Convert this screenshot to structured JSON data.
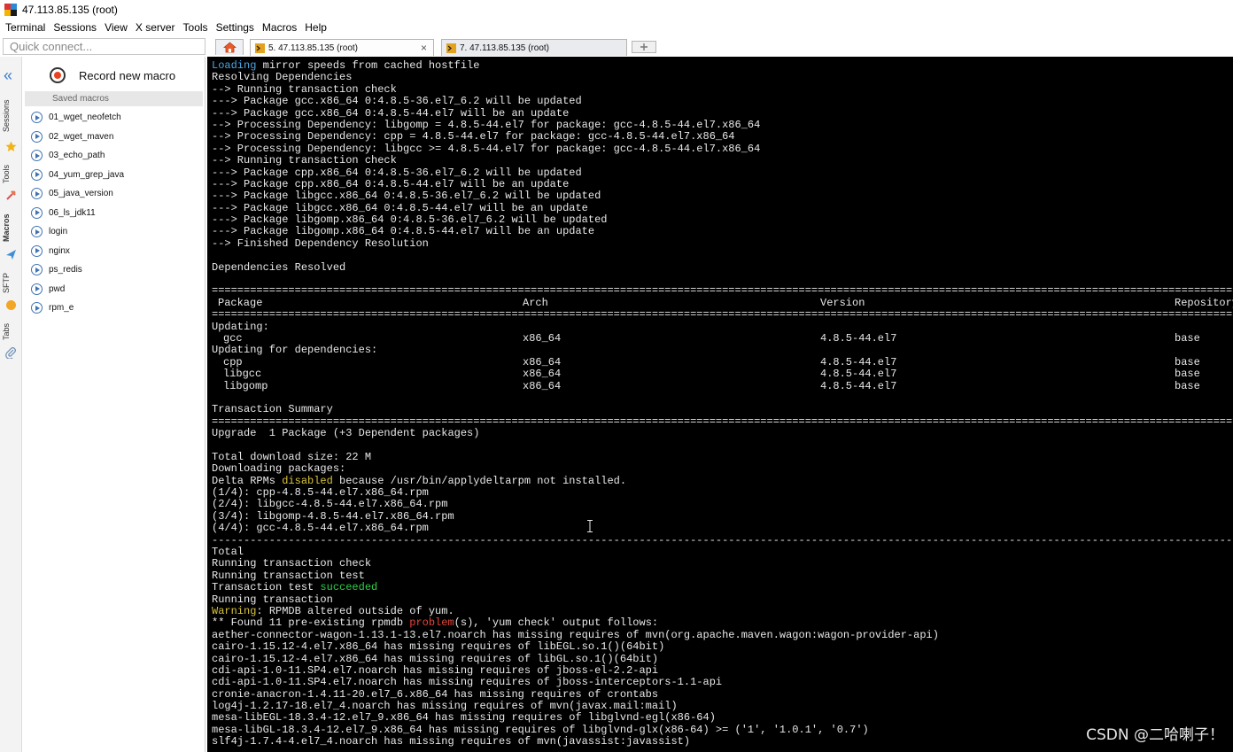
{
  "window": {
    "title": "47.113.85.135 (root)"
  },
  "menu": [
    "Terminal",
    "Sessions",
    "View",
    "X server",
    "Tools",
    "Settings",
    "Macros",
    "Help"
  ],
  "quick_connect": {
    "placeholder": "Quick connect..."
  },
  "tabs": [
    {
      "label": "5. 47.113.85.135 (root)",
      "active": true,
      "close": "×"
    },
    {
      "label": "7. 47.113.85.135 (root)",
      "active": false
    }
  ],
  "side_tabs": [
    "Sessions",
    "Tools",
    "Macros",
    "SFTP",
    "Tabs"
  ],
  "macros": {
    "record_label": "Record new macro",
    "saved_header": "Saved macros",
    "items": [
      "01_wget_neofetch",
      "02_wget_maven",
      "03_echo_path",
      "04_yum_grep_java",
      "05_java_version",
      "06_ls_jdk11",
      "login",
      "nginx",
      "ps_redis",
      "pwd",
      "rpm_e"
    ]
  },
  "terminal": {
    "lines_a": [
      {
        "pre": "",
        "hl": "Loading",
        "hl_color": "blue",
        "post": " mirror speeds from cached hostfile"
      },
      {
        "pre": "Resolving Dependencies"
      },
      {
        "pre": "--> Running transaction check"
      },
      {
        "pre": "---> Package gcc.x86_64 0:4.8.5-36.el7_6.2 will be updated"
      },
      {
        "pre": "---> Package gcc.x86_64 0:4.8.5-44.el7 will be an update"
      },
      {
        "pre": "--> Processing Dependency: libgomp = 4.8.5-44.el7 for package: gcc-4.8.5-44.el7.x86_64"
      },
      {
        "pre": "--> Processing Dependency: cpp = 4.8.5-44.el7 for package: gcc-4.8.5-44.el7.x86_64"
      },
      {
        "pre": "--> Processing Dependency: libgcc >= 4.8.5-44.el7 for package: gcc-4.8.5-44.el7.x86_64"
      },
      {
        "pre": "--> Running transaction check"
      },
      {
        "pre": "---> Package cpp.x86_64 0:4.8.5-36.el7_6.2 will be updated"
      },
      {
        "pre": "---> Package cpp.x86_64 0:4.8.5-44.el7 will be an update"
      },
      {
        "pre": "---> Package libgcc.x86_64 0:4.8.5-36.el7_6.2 will be updated"
      },
      {
        "pre": "---> Package libgcc.x86_64 0:4.8.5-44.el7 will be an update"
      },
      {
        "pre": "---> Package libgomp.x86_64 0:4.8.5-36.el7_6.2 will be updated"
      },
      {
        "pre": "---> Package libgomp.x86_64 0:4.8.5-44.el7 will be an update"
      },
      {
        "pre": "--> Finished Dependency Resolution"
      },
      {
        "pre": ""
      },
      {
        "pre": "Dependencies Resolved"
      },
      {
        "pre": ""
      },
      {
        "pre": "================================================================================================================================================================================"
      }
    ],
    "table_header": {
      "package": "Package",
      "arch": "Arch",
      "version": "Version",
      "repo": "Repository"
    },
    "separator": "================================================================================================================================================================================",
    "updating_label": "Updating:",
    "updating_rows": [
      {
        "package": "gcc",
        "arch": "x86_64",
        "version": "4.8.5-44.el7",
        "repo": "base"
      }
    ],
    "deps_label": "Updating for dependencies:",
    "deps_rows": [
      {
        "package": "cpp",
        "arch": "x86_64",
        "version": "4.8.5-44.el7",
        "repo": "base"
      },
      {
        "package": "libgcc",
        "arch": "x86_64",
        "version": "4.8.5-44.el7",
        "repo": "base"
      },
      {
        "package": "libgomp",
        "arch": "x86_64",
        "version": "4.8.5-44.el7",
        "repo": "base"
      }
    ],
    "lines_b": [
      {
        "pre": ""
      },
      {
        "pre": "Transaction Summary"
      },
      {
        "pre": "================================================================================================================================================================================"
      },
      {
        "pre": "Upgrade  1 Package (+3 Dependent packages)"
      },
      {
        "pre": ""
      },
      {
        "pre": "Total download size: 22 M"
      },
      {
        "pre": "Downloading packages:"
      },
      {
        "pre": "Delta RPMs ",
        "hl": "disabled",
        "hl_color": "yellow",
        "post": " because /usr/bin/applydeltarpm not installed."
      },
      {
        "pre": "(1/4): cpp-4.8.5-44.el7.x86_64.rpm"
      },
      {
        "pre": "(2/4): libgcc-4.8.5-44.el7.x86_64.rpm"
      },
      {
        "pre": "(3/4): libgomp-4.8.5-44.el7.x86_64.rpm"
      },
      {
        "pre": "(4/4): gcc-4.8.5-44.el7.x86_64.rpm"
      },
      {
        "pre": "--------------------------------------------------------------------------------------------------------------------------------------------------------------------------------"
      },
      {
        "pre": "Total"
      },
      {
        "pre": "Running transaction check"
      },
      {
        "pre": "Running transaction test"
      },
      {
        "pre": "Transaction test ",
        "hl": "succeeded",
        "hl_color": "green",
        "post": ""
      },
      {
        "pre": "Running transaction"
      },
      {
        "pre": "",
        "hl": "Warning",
        "hl_color": "yellow",
        "post": ": RPMDB altered outside of yum."
      },
      {
        "pre": "** Found 11 pre-existing rpmdb ",
        "hl": "problem",
        "hl_color": "red",
        "post": "(s), 'yum check' output follows:"
      },
      {
        "pre": "aether-connector-wagon-1.13.1-13.el7.noarch has missing requires of mvn(org.apache.maven.wagon:wagon-provider-api)"
      },
      {
        "pre": "cairo-1.15.12-4.el7.x86_64 has missing requires of libEGL.so.1()(64bit)"
      },
      {
        "pre": "cairo-1.15.12-4.el7.x86_64 has missing requires of libGL.so.1()(64bit)"
      },
      {
        "pre": "cdi-api-1.0-11.SP4.el7.noarch has missing requires of jboss-el-2.2-api"
      },
      {
        "pre": "cdi-api-1.0-11.SP4.el7.noarch has missing requires of jboss-interceptors-1.1-api"
      },
      {
        "pre": "cronie-anacron-1.4.11-20.el7_6.x86_64 has missing requires of crontabs"
      },
      {
        "pre": "log4j-1.2.17-18.el7_4.noarch has missing requires of mvn(javax.mail:mail)"
      },
      {
        "pre": "mesa-libEGL-18.3.4-12.el7_9.x86_64 has missing requires of libglvnd-egl(x86-64)"
      },
      {
        "pre": "mesa-libGL-18.3.4-12.el7_9.x86_64 has missing requires of libglvnd-glx(x86-64) >= ('1', '1.0.1', '0.7')"
      },
      {
        "pre": "slf4j-1.7.4-4.el7_4.noarch has missing requires of mvn(javassist:javassist)"
      }
    ]
  },
  "watermark": "CSDN @二哈喇子！",
  "colors": {
    "terminal_bg": "#000000",
    "accent_blue": "#3d7cc9",
    "record_red": "#e9421f"
  }
}
